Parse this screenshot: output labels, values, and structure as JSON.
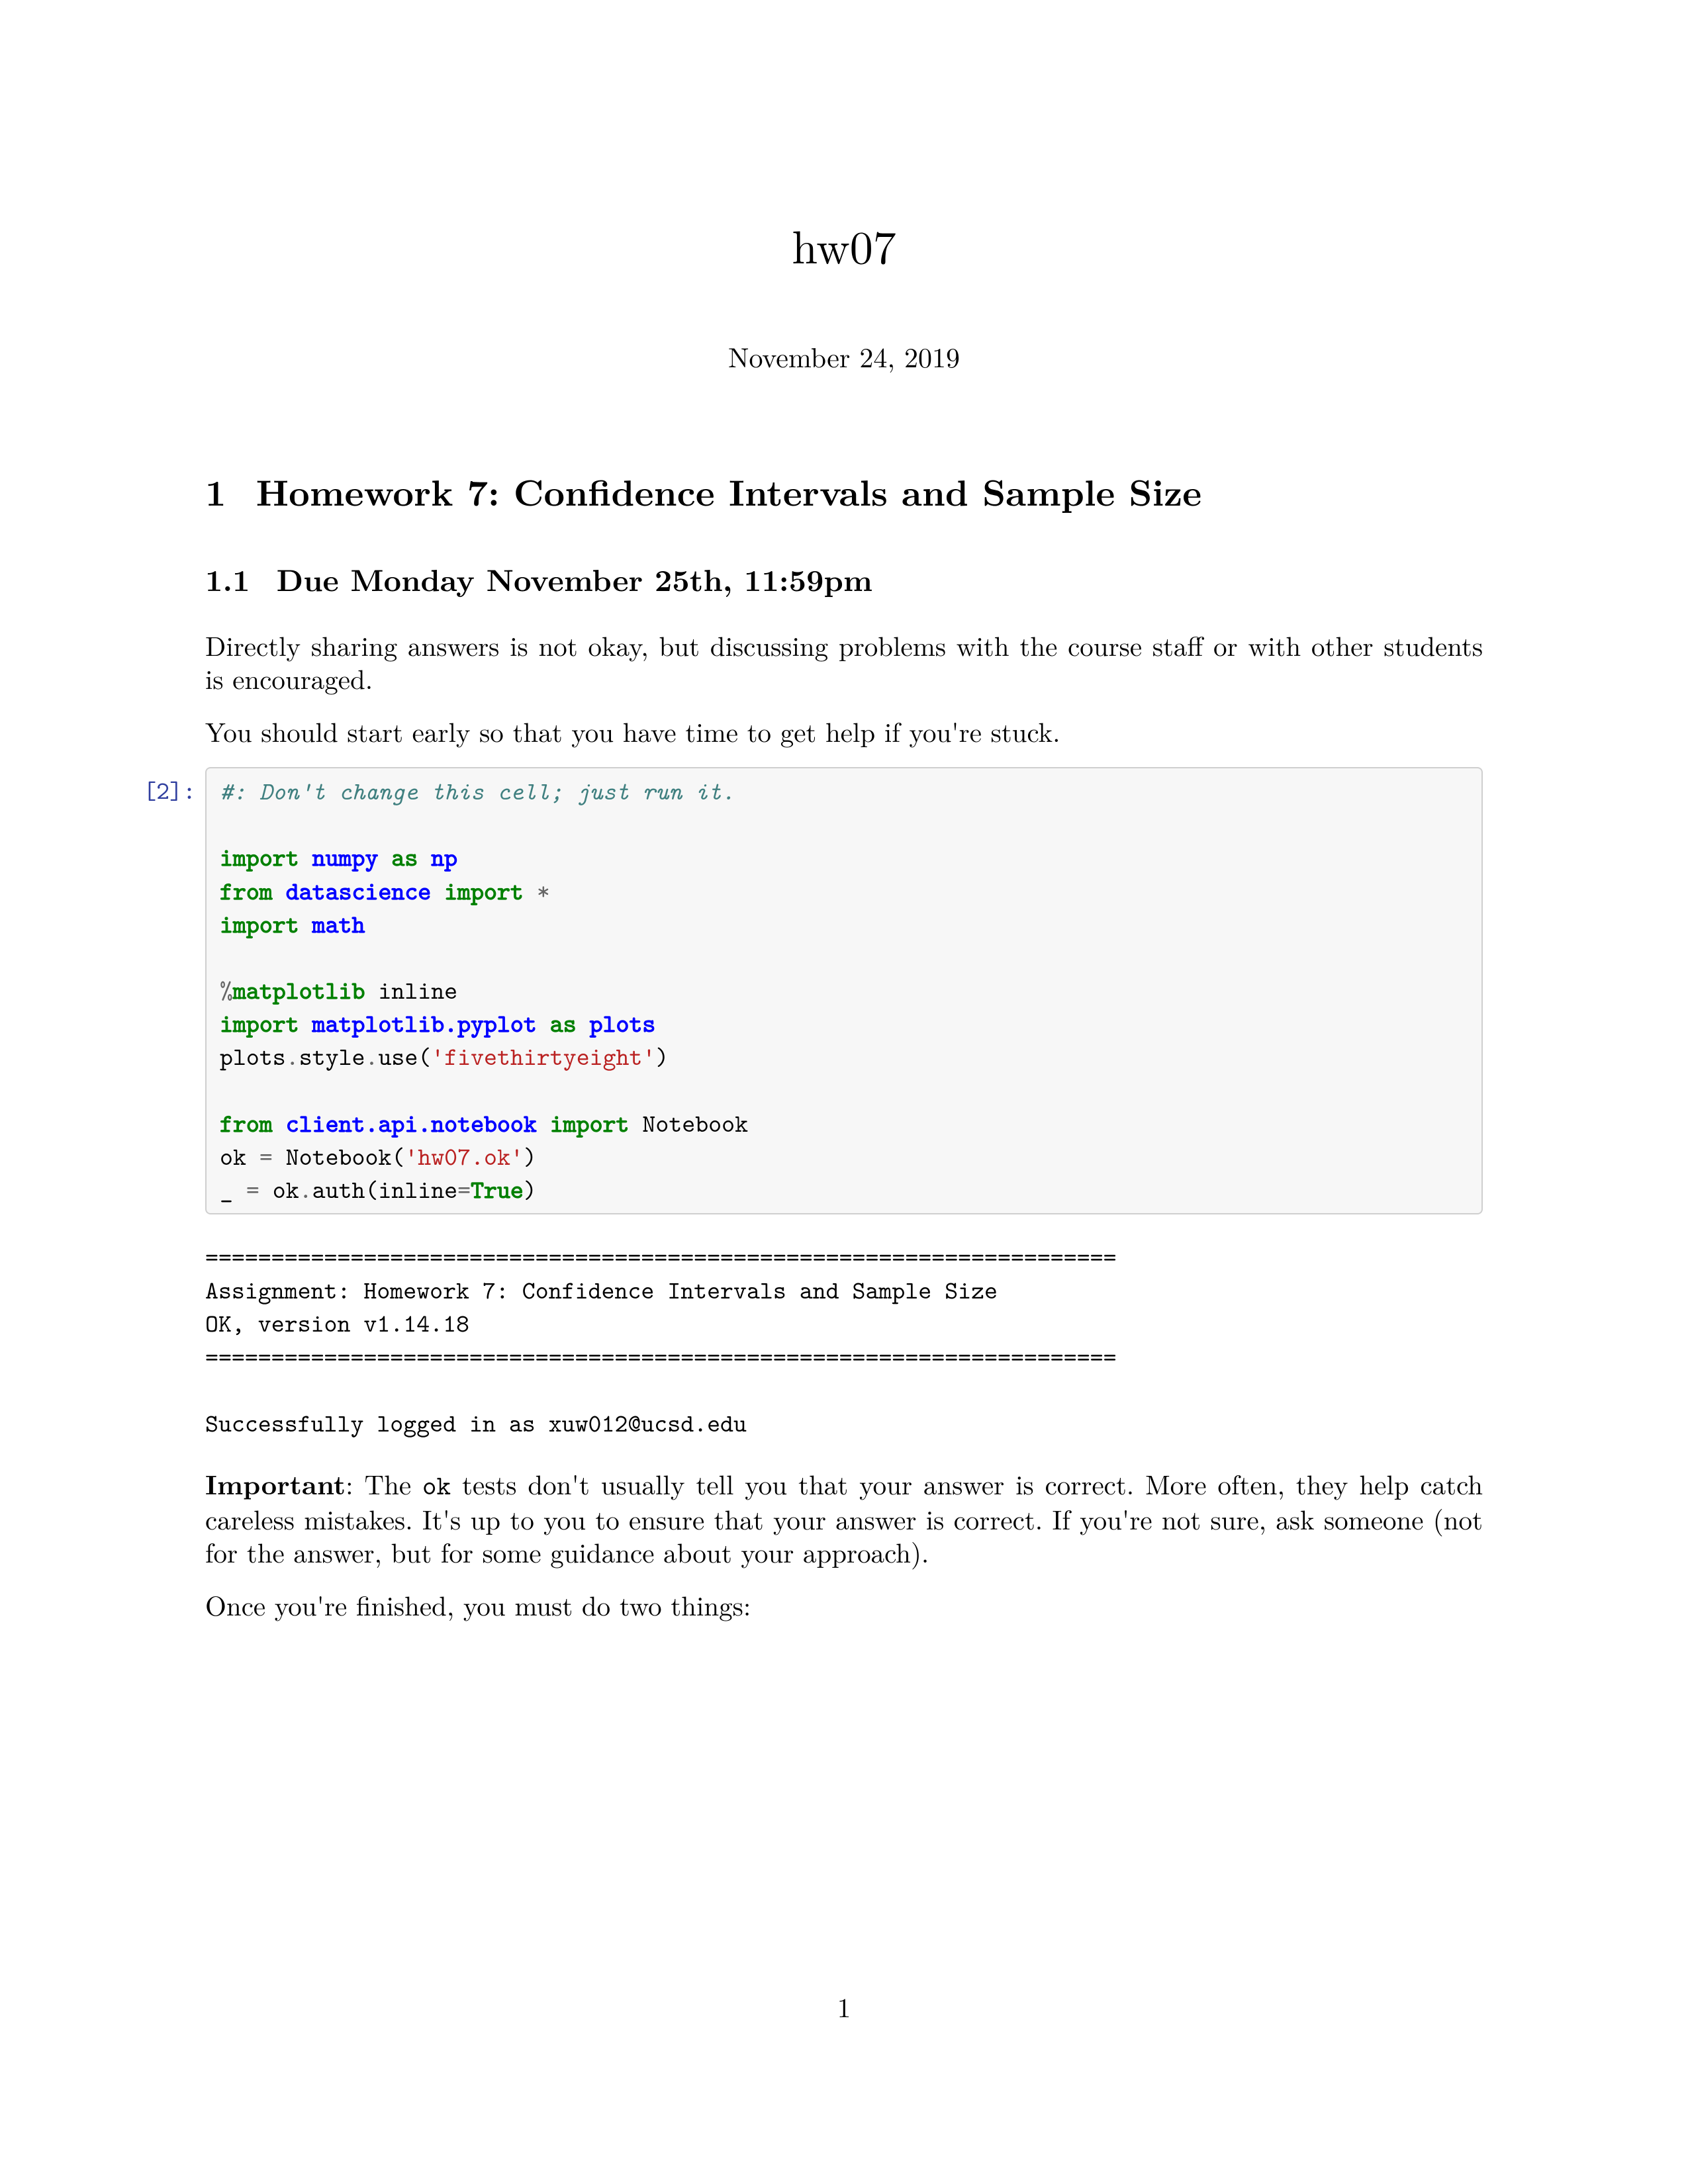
{
  "doc": {
    "title": "hw07",
    "date": "November 24, 2019",
    "page_number": "1"
  },
  "section": {
    "number": "1",
    "title": "Homework 7: Confidence Intervals and Sample Size"
  },
  "subsection": {
    "number": "1.1",
    "title": "Due Monday November 25th, 11:59pm"
  },
  "paragraphs": {
    "p1": "Directly sharing answers is not okay, but discussing problems with the course staff or with other students is encouraged.",
    "p2": "You should start early so that you have time to get help if you're stuck.",
    "important_label": "Important",
    "p3a": ": The ",
    "p3_code": "ok",
    "p3b": " tests don't usually tell you that your answer is correct. More often, they help catch careless mistakes. It's up to you to ensure that your answer is correct. If you're not sure, ask someone (not for the answer, but for some guidance about your approach).",
    "p4": "Once you're finished, you must do two things:"
  },
  "cell": {
    "prompt": "[2]:",
    "code": {
      "c1": "#: Don't change this cell; just run it.",
      "l3_import": "import",
      "l3_numpy": "numpy",
      "l3_as": "as",
      "l3_np": "np",
      "l4_from": "from",
      "l4_ds": "datascience",
      "l4_import": "import",
      "l4_star": "*",
      "l5_import": "import",
      "l5_math": "math",
      "l7_pct": "%",
      "l7_mpl": "matplotlib",
      "l7_inline": " inline",
      "l8_import": "import",
      "l8_mpp": "matplotlib.pyplot",
      "l8_as": "as",
      "l8_plots": "plots",
      "l9_a": "plots",
      "l9_dot1": ".",
      "l9_b": "style",
      "l9_dot2": ".",
      "l9_c": "use(",
      "l9_str": "'fivethirtyeight'",
      "l9_d": ")",
      "l11_from": "from",
      "l11_mod": "client.api.notebook",
      "l11_import": "import",
      "l11_nb": " Notebook",
      "l12_a": "ok ",
      "l12_eq": "=",
      "l12_b": " Notebook(",
      "l12_str": "'hw07.ok'",
      "l12_c": ")",
      "l13_a": "_ ",
      "l13_eq": "=",
      "l13_b": " ok",
      "l13_dot": ".",
      "l13_c": "auth(inline",
      "l13_eq2": "=",
      "l13_true": "True",
      "l13_d": ")"
    }
  },
  "output": {
    "block": "=====================================================================\nAssignment: Homework 7: Confidence Intervals and Sample Size\nOK, version v1.14.18\n=====================================================================\n\nSuccessfully logged in as xuw012@ucsd.edu"
  }
}
